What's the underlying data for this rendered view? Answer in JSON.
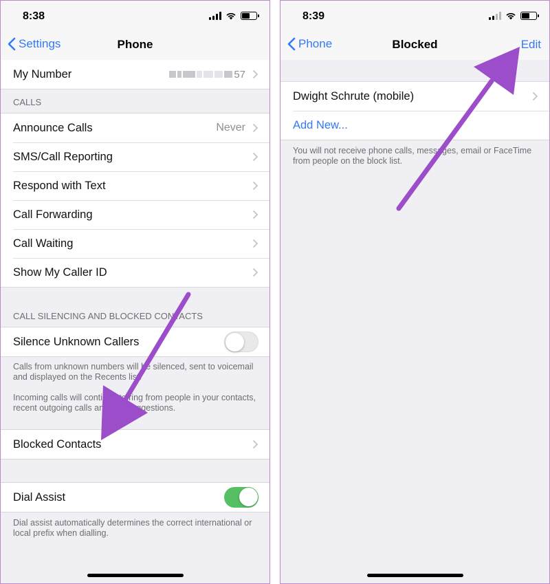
{
  "left": {
    "status": {
      "time": "8:38"
    },
    "nav": {
      "back_label": "Settings",
      "title": "Phone"
    },
    "my_number": {
      "label": "My Number",
      "partial_number": "57"
    },
    "calls_header": "CALLS",
    "calls_items": [
      {
        "label": "Announce Calls",
        "value": "Never"
      },
      {
        "label": "SMS/Call Reporting",
        "value": ""
      },
      {
        "label": "Respond with Text",
        "value": ""
      },
      {
        "label": "Call Forwarding",
        "value": ""
      },
      {
        "label": "Call Waiting",
        "value": ""
      },
      {
        "label": "Show My Caller ID",
        "value": ""
      }
    ],
    "silencing_header": "CALL SILENCING AND BLOCKED CONTACTS",
    "silence_unknown": {
      "label": "Silence Unknown Callers",
      "enabled": false
    },
    "silence_footer_1": "Calls from unknown numbers will be silenced, sent to voicemail and displayed on the Recents list.",
    "silence_footer_2": "Incoming calls will continue to ring from people in your contacts, recent outgoing calls and Siri Suggestions.",
    "blocked_contacts": {
      "label": "Blocked Contacts"
    },
    "dial_assist": {
      "label": "Dial Assist",
      "enabled": true
    },
    "dial_assist_footer": "Dial assist automatically determines the correct international or local prefix when dialling."
  },
  "right": {
    "status": {
      "time": "8:39"
    },
    "nav": {
      "back_label": "Phone",
      "title": "Blocked",
      "action_label": "Edit"
    },
    "blocked_list": [
      {
        "label": "Dwight Schrute (mobile)"
      }
    ],
    "add_new_label": "Add New...",
    "footer": "You will not receive phone calls, messages, email or FaceTime from people on the block list."
  },
  "colors": {
    "accent": "#3478f6",
    "toggle_on": "#57bf63",
    "annotation_arrow": "#9b4dca"
  }
}
